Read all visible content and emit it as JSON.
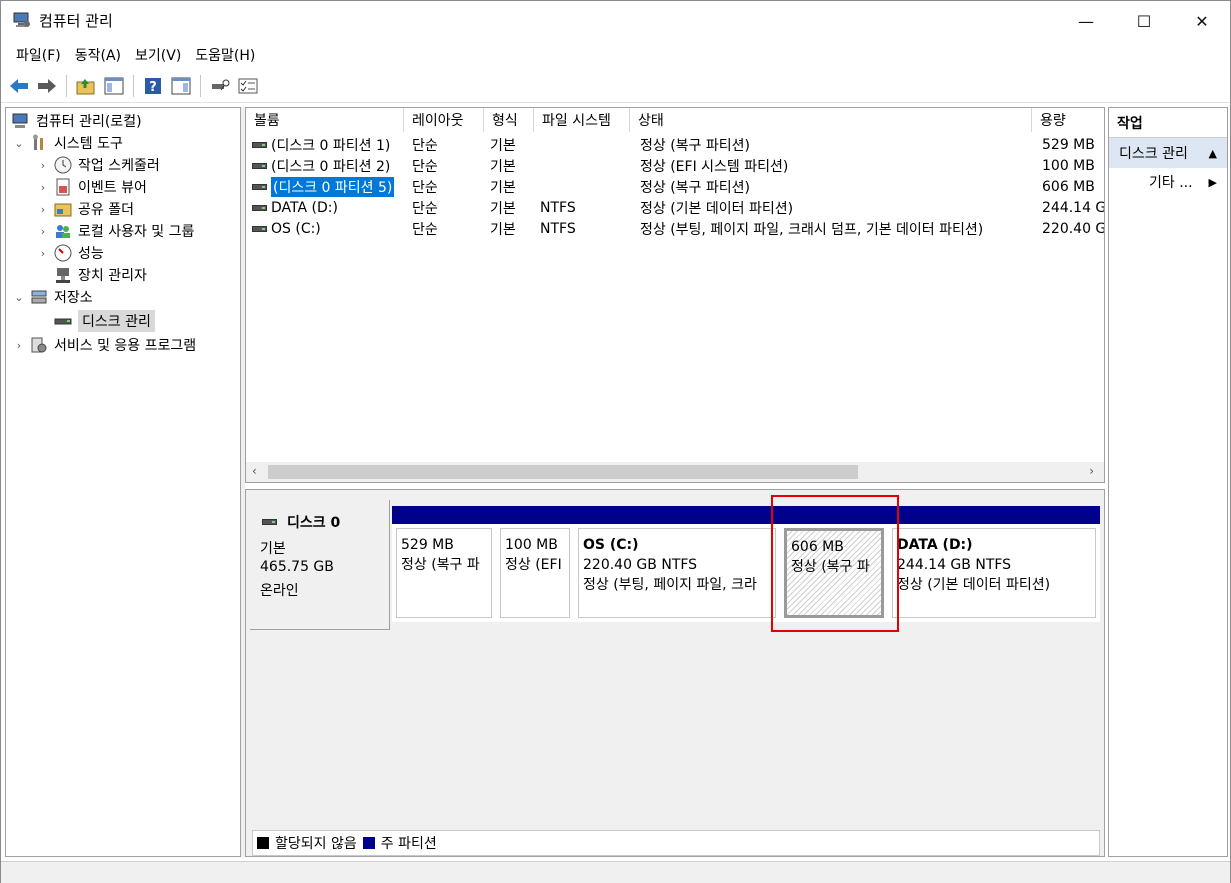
{
  "window": {
    "title": "컴퓨터 관리",
    "minimize": "—",
    "maximize": "☐",
    "close": "✕"
  },
  "menu": [
    "파일(F)",
    "동작(A)",
    "보기(V)",
    "도움말(H)"
  ],
  "tree": {
    "root": "컴퓨터 관리(로컬)",
    "system_tools": "시스템 도구",
    "task_scheduler": "작업 스케줄러",
    "event_viewer": "이벤트 뷰어",
    "shared_folders": "공유 폴더",
    "local_users": "로컬 사용자 및 그룹",
    "performance": "성능",
    "device_manager": "장치 관리자",
    "storage": "저장소",
    "disk_management": "디스크 관리",
    "services_apps": "서비스 및 응용 프로그램"
  },
  "volumes": {
    "columns": [
      "볼륨",
      "레이아웃",
      "형식",
      "파일 시스템",
      "상태",
      "용량"
    ],
    "rows": [
      {
        "volume": "(디스크 0 파티션 1)",
        "layout": "단순",
        "type": "기본",
        "fs": "",
        "status": "정상 (복구 파티션)",
        "capacity": "529 MB",
        "selected": false
      },
      {
        "volume": "(디스크 0 파티션 2)",
        "layout": "단순",
        "type": "기본",
        "fs": "",
        "status": "정상 (EFI 시스템 파티션)",
        "capacity": "100 MB",
        "selected": false
      },
      {
        "volume": "(디스크 0 파티션 5)",
        "layout": "단순",
        "type": "기본",
        "fs": "",
        "status": "정상 (복구 파티션)",
        "capacity": "606 MB",
        "selected": true
      },
      {
        "volume": "DATA (D:)",
        "layout": "단순",
        "type": "기본",
        "fs": "NTFS",
        "status": "정상 (기본 데이터 파티션)",
        "capacity": "244.14 G",
        "selected": false
      },
      {
        "volume": "OS (C:)",
        "layout": "단순",
        "type": "기본",
        "fs": "NTFS",
        "status": "정상 (부팅, 페이지 파일, 크래시 덤프, 기본 데이터 파티션)",
        "capacity": "220.40 G",
        "selected": false
      }
    ]
  },
  "disk": {
    "name": "디스크 0",
    "type": "기본",
    "size": "465.75 GB",
    "state": "온라인",
    "partitions": [
      {
        "title": "",
        "size": "529 MB",
        "status": "정상 (복구 파"
      },
      {
        "title": "",
        "size": "100 MB",
        "status": "정상 (EFI"
      },
      {
        "title": "OS  (C:)",
        "size": "220.40 GB NTFS",
        "status": "정상 (부팅, 페이지 파일, 크라"
      },
      {
        "title": "",
        "size": "606 MB",
        "status": "정상 (복구 파"
      },
      {
        "title": "DATA  (D:)",
        "size": "244.14 GB NTFS",
        "status": "정상 (기본 데이터 파티션)"
      }
    ]
  },
  "legend": {
    "unallocated": "할당되지 않음",
    "primary": "주 파티션",
    "unallocated_color": "#000000",
    "primary_color": "#00008b"
  },
  "actions": {
    "header": "작업",
    "section": "디스크 관리",
    "more": "기타 ..."
  },
  "colors": {
    "selection": "#0078d7",
    "partition_bar": "#00008b",
    "highlight": "#e60000"
  }
}
